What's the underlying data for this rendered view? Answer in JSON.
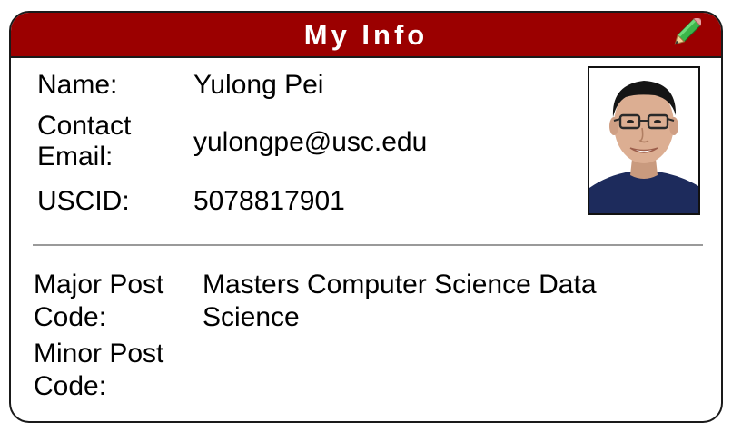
{
  "card": {
    "title": "My Info",
    "edit_icon": "pencil-icon"
  },
  "contact": {
    "name_label": "Name:",
    "name_value": "Yulong Pei",
    "email_label_line1": "Contact",
    "email_label_line2": "Email:",
    "email_value": "yulongpe@usc.edu",
    "uscid_label": "USCID:",
    "uscid_value": "5078817901"
  },
  "codes": {
    "major_label_line1": "Major Post",
    "major_label_line2": "Code:",
    "major_value_line1": "Masters Computer Science Data",
    "major_value_line2": "Science",
    "minor_label_line1": "Minor Post",
    "minor_label_line2": "Code:"
  },
  "colors": {
    "header_bg": "#9b0000",
    "header_text": "#ffffff",
    "border": "#1a1a1a",
    "divider": "#9a9a9a"
  }
}
